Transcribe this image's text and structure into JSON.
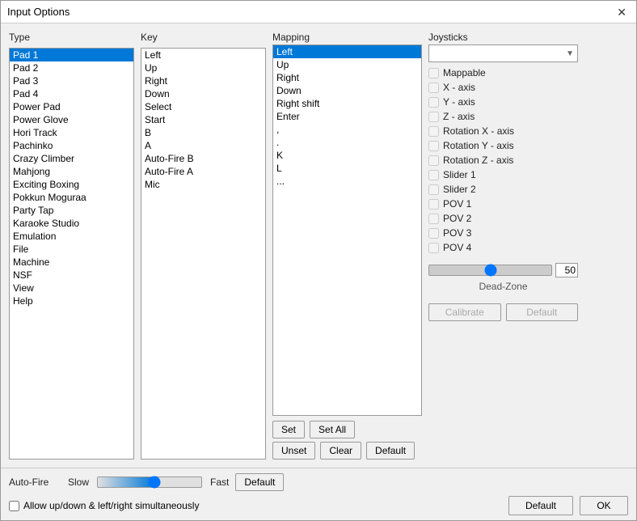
{
  "window": {
    "title": "Input Options",
    "close_label": "✕"
  },
  "type_panel": {
    "label": "Type",
    "items": [
      "Pad 1",
      "Pad 2",
      "Pad 3",
      "Pad 4",
      "Power Pad",
      "Power Glove",
      "Hori Track",
      "Pachinko",
      "Crazy Climber",
      "Mahjong",
      "Exciting Boxing",
      "Pokkun Moguraa",
      "Party Tap",
      "Karaoke Studio",
      "Emulation",
      "File",
      "Machine",
      "NSF",
      "View",
      "Help"
    ],
    "selected_index": 0
  },
  "key_panel": {
    "label": "Key",
    "items": [
      "Left",
      "Up",
      "Right",
      "Down",
      "Select",
      "Start",
      "B",
      "A",
      "Auto-Fire B",
      "Auto-Fire A",
      "Mic"
    ],
    "selected_index": -1
  },
  "mapping_panel": {
    "label": "Mapping",
    "items": [
      "Left",
      "Up",
      "Right",
      "Down",
      "Right shift",
      "Enter",
      ",",
      ".",
      "K",
      "L",
      "..."
    ],
    "selected_index": 0
  },
  "mapping_buttons": {
    "set_label": "Set",
    "set_all_label": "Set All",
    "unset_label": "Unset",
    "clear_label": "Clear",
    "default_label": "Default"
  },
  "joysticks_panel": {
    "label": "Joysticks",
    "dropdown_placeholder": "",
    "checkboxes": [
      {
        "label": "Mappable",
        "checked": false
      },
      {
        "label": "X - axis",
        "checked": false
      },
      {
        "label": "Y - axis",
        "checked": false
      },
      {
        "label": "Z - axis",
        "checked": false
      },
      {
        "label": "Rotation X - axis",
        "checked": false
      },
      {
        "label": "Rotation Y - axis",
        "checked": false
      },
      {
        "label": "Rotation Z - axis",
        "checked": false
      },
      {
        "label": "Slider 1",
        "checked": false
      },
      {
        "label": "Slider 2",
        "checked": false
      },
      {
        "label": "POV 1",
        "checked": false
      },
      {
        "label": "POV 2",
        "checked": false
      },
      {
        "label": "POV 3",
        "checked": false
      },
      {
        "label": "POV 4",
        "checked": false
      }
    ],
    "deadzone_value": "50",
    "deadzone_label": "Dead-Zone",
    "calibrate_label": "Calibrate",
    "default_label": "Default"
  },
  "autofire": {
    "label": "Auto-Fire",
    "slow_label": "Slow",
    "fast_label": "Fast",
    "default_label": "Default"
  },
  "bottom": {
    "allow_checkbox_label": "Allow up/down & left/right simultaneously",
    "allow_checked": false,
    "default_label": "Default",
    "ok_label": "OK"
  }
}
